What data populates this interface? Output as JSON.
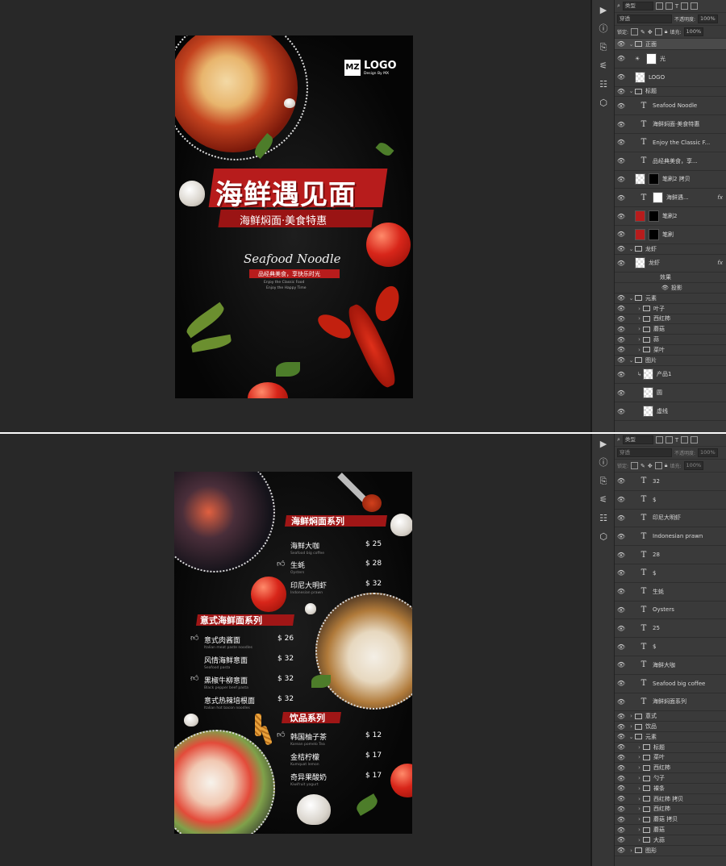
{
  "poster1": {
    "logo_mark": "MZ",
    "logo_text": "LOGO",
    "logo_sub": "Design By MX",
    "headline": "海鲜遇见面",
    "subhead": "海鲜焖面·美食特惠",
    "script_title": "Seafood Noodle",
    "tagline": "品经典美食，享快乐时光",
    "tagline_en1": "Enjoy the Classic Food",
    "tagline_en2": "Enjoy the Happy Time"
  },
  "poster2": {
    "section1": {
      "title": "海鲜焖面系列",
      "items": [
        {
          "name": "海鲜大咖",
          "en": "Seafood big coffee",
          "price": "$ 25"
        },
        {
          "name": "生蚝",
          "en": "Oysters",
          "price": "$ 28"
        },
        {
          "name": "印尼大明虾",
          "en": "Indonesian prawn",
          "price": "$ 32"
        }
      ]
    },
    "section2": {
      "title": "意式海鲜面系列",
      "items": [
        {
          "name": "意式肉酱面",
          "en": "Italian meat paste noodles",
          "price": "$ 26"
        },
        {
          "name": "风情海鲜意面",
          "en": "Seafood pasta",
          "price": "$ 32"
        },
        {
          "name": "黑椒牛柳意面",
          "en": "Black pepper beef pasta",
          "price": "$ 32"
        },
        {
          "name": "意式热辣培根面",
          "en": "Italian hot bacon noodles",
          "price": "$ 32"
        }
      ]
    },
    "section3": {
      "title": "饮品系列",
      "items": [
        {
          "name": "韩国柚子茶",
          "en": "Korean pomelo Tea",
          "price": "$ 12"
        },
        {
          "name": "金桔柠檬",
          "en": "Kumquat lemon",
          "price": "$ 17"
        },
        {
          "name": "奇异果酸奶",
          "en": "Kiwifruit yogurt",
          "price": "$ 17"
        }
      ]
    }
  },
  "panel_top": {
    "filter_kind": "类型",
    "blend_mode": "穿透",
    "opacity_label": "不透明度:",
    "opacity_value": "100%",
    "lock_label": "锁定:",
    "fill_label": "填充:",
    "fill_value": "100%",
    "layers": [
      "正面",
      "光",
      "LOGO",
      "标题",
      "Seafood Noodle",
      "海鲜焖面·美食特惠",
      "Enjoy the Classic F...",
      "品经典美食，享...",
      "笔刷2 拷贝",
      "海鲜遇...",
      "笔刷2",
      "笔刷",
      "龙虾",
      "龙虾",
      "效果",
      "投影",
      "元素",
      "叶子",
      "西红柿",
      "蘑菇",
      "蒜",
      "菜叶",
      "图片",
      "产品1",
      "圆",
      "虚线"
    ]
  },
  "panel_bottom": {
    "filter_kind": "类型",
    "blend_mode": "穿透",
    "opacity_label": "不透明度:",
    "opacity_value": "100%",
    "lock_label": "锁定:",
    "fill_label": "填充:",
    "fill_value": "100%",
    "text_layers": [
      "32",
      "$",
      "印尼大明虾",
      "Indonesian prawn",
      "28",
      "$",
      "生蚝",
      "Oysters",
      "25",
      "$",
      "海鲜大咖",
      "Seafood big coffee",
      "海鲜焖面系列"
    ],
    "folders": [
      "意式",
      "饮品",
      "元素",
      "标题",
      "菜叶",
      "西红柿",
      "勺子",
      "裸条",
      "西红柿 拷贝",
      "西红柿",
      "蘑菇 拷贝",
      "蘑菇",
      "大蒜",
      "图形"
    ]
  },
  "colors": {
    "accent_red": "#b71c1c",
    "canvas_bg": "#282828",
    "panel_bg": "#3a3a3a"
  }
}
